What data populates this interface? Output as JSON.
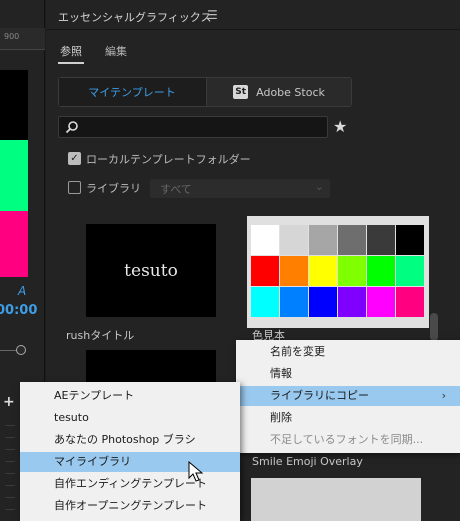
{
  "left_panel": {
    "ruler_label": "900",
    "swatches": [
      {
        "color": "#00ff80"
      },
      {
        "color": "#ff0080"
      }
    ],
    "timecode_fragment": "00:00",
    "a_glyph": "A"
  },
  "panel": {
    "title": "エッセンシャルグラフィックス",
    "tabs": [
      "参照",
      "編集"
    ],
    "segments": {
      "my_templates": "マイテンプレート",
      "adobe_stock": "Adobe Stock",
      "stock_badge": "St"
    },
    "search_placeholder": "",
    "local_templates_label": "ローカルテンプレートフォルダー",
    "library_label": "ライブラリ",
    "library_dropdown": "すべて",
    "thumbnails": [
      {
        "caption": "rushタイトル",
        "text": "tesuto"
      },
      {
        "caption": "色見本"
      },
      {
        "caption": "Smile Emoji Overlay"
      }
    ],
    "colors": {
      "row1": [
        "#ffffff",
        "#d6d6d6",
        "#a6a6a6",
        "#6e6e6e",
        "#3a3a3a",
        "#000000"
      ],
      "row2": [
        "#ff0000",
        "#ff8000",
        "#ffff00",
        "#80ff00",
        "#00ff00",
        "#00ff80"
      ],
      "row3": [
        "#00ffff",
        "#0080ff",
        "#0000ff",
        "#8000ff",
        "#ff00ff",
        "#ff0080"
      ]
    }
  },
  "context_menu": {
    "items": [
      {
        "label": "名前を変更"
      },
      {
        "label": "情報"
      },
      {
        "label": "ライブラリにコピー",
        "submenu": true
      },
      {
        "label": "削除"
      },
      {
        "label": "不足しているフォントを同期..."
      }
    ]
  },
  "submenu": {
    "items": [
      {
        "label": "AEテンプレート"
      },
      {
        "label": "tesuto"
      },
      {
        "label": "あなたの Photoshop ブラシ"
      },
      {
        "label": "マイライブラリ"
      },
      {
        "label": "自作エンディングテンプレート"
      },
      {
        "label": "自作オープニングテンプレート"
      }
    ]
  },
  "icons": {
    "menu": "hamburger-icon",
    "search": "search-icon",
    "favorite": "star-icon",
    "submenu_arrow": "chevron-right-icon",
    "cursor": "mouse-pointer-icon"
  }
}
